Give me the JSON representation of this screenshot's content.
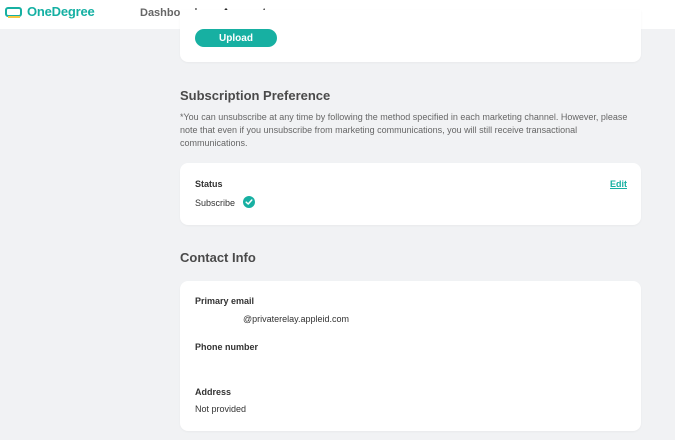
{
  "app": {
    "logo_text": "OneDegree",
    "brand_color": "#17b0a2",
    "accent_color": "#f5c842"
  },
  "nav": {
    "tabs": [
      {
        "label": "Dashboard",
        "active": false
      },
      {
        "label": "Account",
        "active": true
      }
    ]
  },
  "upload_card": {
    "button_label": "Upload"
  },
  "subscription": {
    "title": "Subscription Preference",
    "note": "*You can unsubscribe at any time by following the method specified in each marketing channel. However, please note that even if you unsubscribe from marketing communications, you will still receive transactional communications.",
    "status_label": "Status",
    "status_value": "Subscribe",
    "status_icon": "check-circle-icon",
    "edit_label": "Edit"
  },
  "contact": {
    "title": "Contact Info",
    "primary_email_label": "Primary email",
    "primary_email_value": "@privaterelay.appleid.com",
    "phone_label": "Phone number",
    "phone_value": "",
    "address_label": "Address",
    "address_value": "Not provided"
  }
}
